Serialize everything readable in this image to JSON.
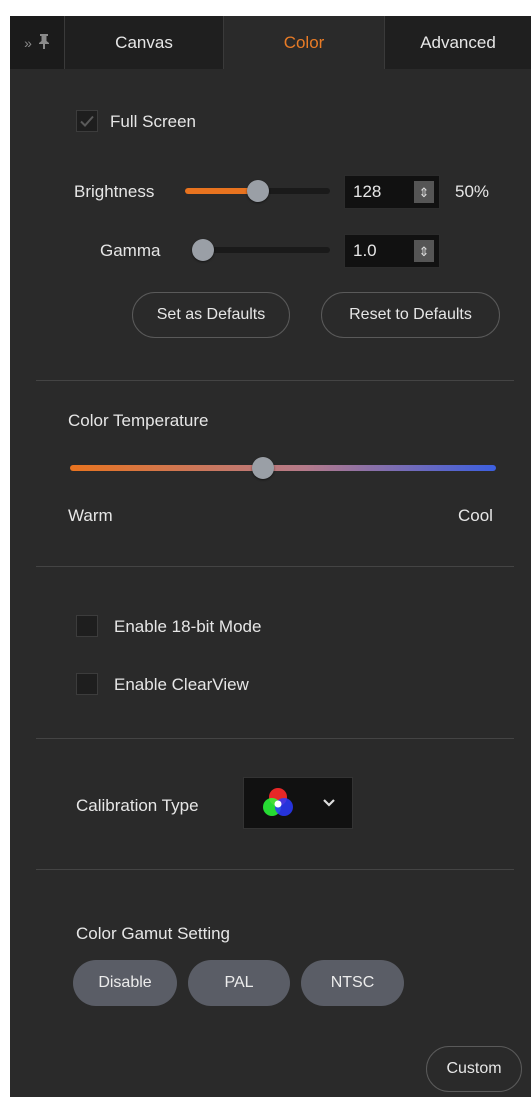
{
  "tabs": {
    "canvas": "Canvas",
    "color": "Color",
    "advanced": "Advanced"
  },
  "display": {
    "full_screen_label": "Full Screen",
    "full_screen_checked": true,
    "brightness_label": "Brightness",
    "brightness_value": "128",
    "brightness_percent": "50%",
    "brightness_level": 0.5,
    "gamma_label": "Gamma",
    "gamma_value": "1.0",
    "gamma_level": 0.0,
    "set_defaults": "Set as Defaults",
    "reset_defaults": "Reset to Defaults"
  },
  "temperature": {
    "title": "Color Temperature",
    "warm": "Warm",
    "cool": "Cool",
    "level": 0.45
  },
  "modes": {
    "mode_18bit": "Enable 18-bit Mode",
    "clearview": "Enable ClearView"
  },
  "calibration": {
    "label": "Calibration Type",
    "selected_icon": "rgb-circles-icon"
  },
  "gamut": {
    "label": "Color Gamut Setting",
    "options": [
      "Disable",
      "PAL",
      "NTSC"
    ],
    "custom": "Custom"
  },
  "colors": {
    "accent": "#e8731f",
    "active_tab": "#e87b26",
    "cool": "#3c5fe0"
  }
}
